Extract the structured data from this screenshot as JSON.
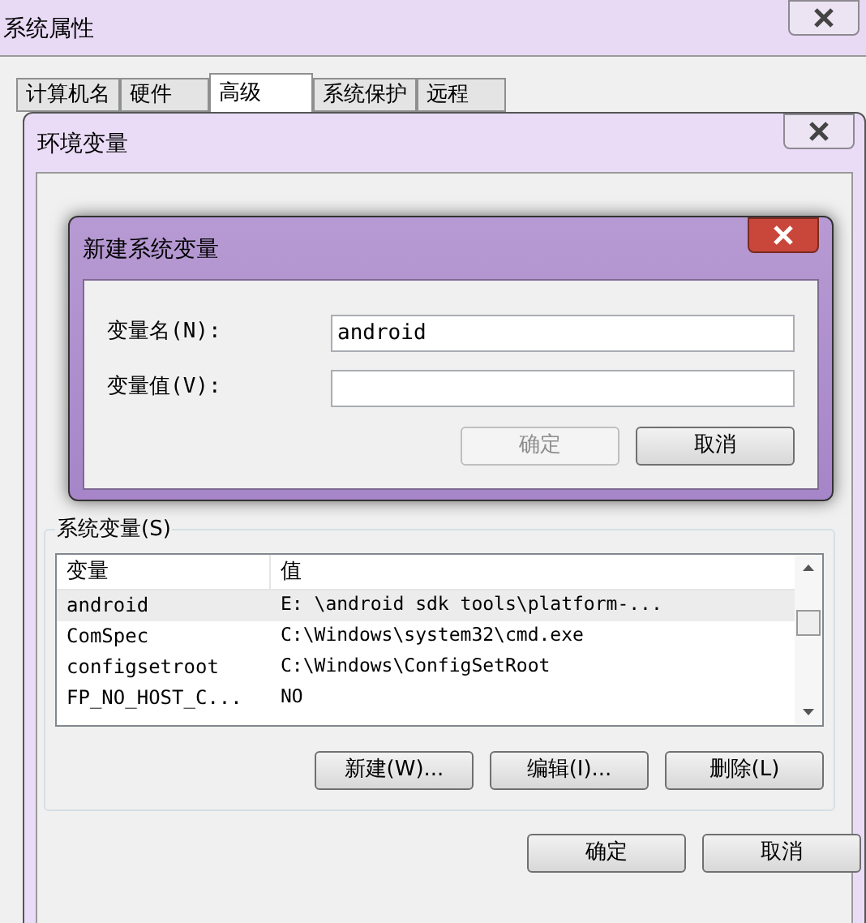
{
  "window": {
    "title": "系统属性"
  },
  "tabs": [
    {
      "label": "计算机名",
      "selected": false
    },
    {
      "label": "硬件",
      "selected": false
    },
    {
      "label": "高级",
      "selected": true
    },
    {
      "label": "系统保护",
      "selected": false
    },
    {
      "label": "远程",
      "selected": false
    }
  ],
  "env_dialog": {
    "title": "环境变量",
    "system_vars": {
      "label": "系统变量(S)",
      "columns": [
        "变量",
        "值"
      ],
      "rows": [
        {
          "name": "android",
          "value": "E: \\android sdk tools\\platform-...",
          "selected": true
        },
        {
          "name": "ComSpec",
          "value": "C:\\Windows\\system32\\cmd.exe",
          "selected": false
        },
        {
          "name": "configsetroot",
          "value": "C:\\Windows\\ConfigSetRoot",
          "selected": false
        },
        {
          "name": "FP_NO_HOST_C...",
          "value": "NO",
          "selected": false
        }
      ],
      "buttons": [
        "新建(W)...",
        "编辑(I)...",
        "删除(L)"
      ]
    },
    "buttons": [
      "确定",
      "取消"
    ]
  },
  "new_var_dialog": {
    "title": "新建系统变量",
    "fields": [
      {
        "label": "变量名(N):",
        "value": "android"
      },
      {
        "label": "变量值(V):"
      }
    ],
    "buttons": [
      {
        "label": "确定",
        "disabled": true
      },
      {
        "label": "取消",
        "disabled": false
      }
    ]
  }
}
